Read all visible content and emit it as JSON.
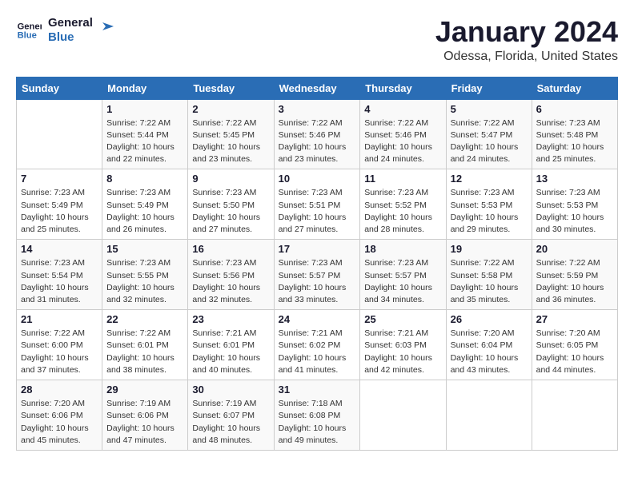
{
  "logo": {
    "line1": "General",
    "line2": "Blue"
  },
  "title": "January 2024",
  "subtitle": "Odessa, Florida, United States",
  "weekdays": [
    "Sunday",
    "Monday",
    "Tuesday",
    "Wednesday",
    "Thursday",
    "Friday",
    "Saturday"
  ],
  "weeks": [
    [
      {
        "day": "",
        "sunrise": "",
        "sunset": "",
        "daylight": ""
      },
      {
        "day": "1",
        "sunrise": "Sunrise: 7:22 AM",
        "sunset": "Sunset: 5:44 PM",
        "daylight": "Daylight: 10 hours and 22 minutes."
      },
      {
        "day": "2",
        "sunrise": "Sunrise: 7:22 AM",
        "sunset": "Sunset: 5:45 PM",
        "daylight": "Daylight: 10 hours and 23 minutes."
      },
      {
        "day": "3",
        "sunrise": "Sunrise: 7:22 AM",
        "sunset": "Sunset: 5:46 PM",
        "daylight": "Daylight: 10 hours and 23 minutes."
      },
      {
        "day": "4",
        "sunrise": "Sunrise: 7:22 AM",
        "sunset": "Sunset: 5:46 PM",
        "daylight": "Daylight: 10 hours and 24 minutes."
      },
      {
        "day": "5",
        "sunrise": "Sunrise: 7:22 AM",
        "sunset": "Sunset: 5:47 PM",
        "daylight": "Daylight: 10 hours and 24 minutes."
      },
      {
        "day": "6",
        "sunrise": "Sunrise: 7:23 AM",
        "sunset": "Sunset: 5:48 PM",
        "daylight": "Daylight: 10 hours and 25 minutes."
      }
    ],
    [
      {
        "day": "7",
        "sunrise": "Sunrise: 7:23 AM",
        "sunset": "Sunset: 5:49 PM",
        "daylight": "Daylight: 10 hours and 25 minutes."
      },
      {
        "day": "8",
        "sunrise": "Sunrise: 7:23 AM",
        "sunset": "Sunset: 5:49 PM",
        "daylight": "Daylight: 10 hours and 26 minutes."
      },
      {
        "day": "9",
        "sunrise": "Sunrise: 7:23 AM",
        "sunset": "Sunset: 5:50 PM",
        "daylight": "Daylight: 10 hours and 27 minutes."
      },
      {
        "day": "10",
        "sunrise": "Sunrise: 7:23 AM",
        "sunset": "Sunset: 5:51 PM",
        "daylight": "Daylight: 10 hours and 27 minutes."
      },
      {
        "day": "11",
        "sunrise": "Sunrise: 7:23 AM",
        "sunset": "Sunset: 5:52 PM",
        "daylight": "Daylight: 10 hours and 28 minutes."
      },
      {
        "day": "12",
        "sunrise": "Sunrise: 7:23 AM",
        "sunset": "Sunset: 5:53 PM",
        "daylight": "Daylight: 10 hours and 29 minutes."
      },
      {
        "day": "13",
        "sunrise": "Sunrise: 7:23 AM",
        "sunset": "Sunset: 5:53 PM",
        "daylight": "Daylight: 10 hours and 30 minutes."
      }
    ],
    [
      {
        "day": "14",
        "sunrise": "Sunrise: 7:23 AM",
        "sunset": "Sunset: 5:54 PM",
        "daylight": "Daylight: 10 hours and 31 minutes."
      },
      {
        "day": "15",
        "sunrise": "Sunrise: 7:23 AM",
        "sunset": "Sunset: 5:55 PM",
        "daylight": "Daylight: 10 hours and 32 minutes."
      },
      {
        "day": "16",
        "sunrise": "Sunrise: 7:23 AM",
        "sunset": "Sunset: 5:56 PM",
        "daylight": "Daylight: 10 hours and 32 minutes."
      },
      {
        "day": "17",
        "sunrise": "Sunrise: 7:23 AM",
        "sunset": "Sunset: 5:57 PM",
        "daylight": "Daylight: 10 hours and 33 minutes."
      },
      {
        "day": "18",
        "sunrise": "Sunrise: 7:23 AM",
        "sunset": "Sunset: 5:57 PM",
        "daylight": "Daylight: 10 hours and 34 minutes."
      },
      {
        "day": "19",
        "sunrise": "Sunrise: 7:22 AM",
        "sunset": "Sunset: 5:58 PM",
        "daylight": "Daylight: 10 hours and 35 minutes."
      },
      {
        "day": "20",
        "sunrise": "Sunrise: 7:22 AM",
        "sunset": "Sunset: 5:59 PM",
        "daylight": "Daylight: 10 hours and 36 minutes."
      }
    ],
    [
      {
        "day": "21",
        "sunrise": "Sunrise: 7:22 AM",
        "sunset": "Sunset: 6:00 PM",
        "daylight": "Daylight: 10 hours and 37 minutes."
      },
      {
        "day": "22",
        "sunrise": "Sunrise: 7:22 AM",
        "sunset": "Sunset: 6:01 PM",
        "daylight": "Daylight: 10 hours and 38 minutes."
      },
      {
        "day": "23",
        "sunrise": "Sunrise: 7:21 AM",
        "sunset": "Sunset: 6:01 PM",
        "daylight": "Daylight: 10 hours and 40 minutes."
      },
      {
        "day": "24",
        "sunrise": "Sunrise: 7:21 AM",
        "sunset": "Sunset: 6:02 PM",
        "daylight": "Daylight: 10 hours and 41 minutes."
      },
      {
        "day": "25",
        "sunrise": "Sunrise: 7:21 AM",
        "sunset": "Sunset: 6:03 PM",
        "daylight": "Daylight: 10 hours and 42 minutes."
      },
      {
        "day": "26",
        "sunrise": "Sunrise: 7:20 AM",
        "sunset": "Sunset: 6:04 PM",
        "daylight": "Daylight: 10 hours and 43 minutes."
      },
      {
        "day": "27",
        "sunrise": "Sunrise: 7:20 AM",
        "sunset": "Sunset: 6:05 PM",
        "daylight": "Daylight: 10 hours and 44 minutes."
      }
    ],
    [
      {
        "day": "28",
        "sunrise": "Sunrise: 7:20 AM",
        "sunset": "Sunset: 6:06 PM",
        "daylight": "Daylight: 10 hours and 45 minutes."
      },
      {
        "day": "29",
        "sunrise": "Sunrise: 7:19 AM",
        "sunset": "Sunset: 6:06 PM",
        "daylight": "Daylight: 10 hours and 47 minutes."
      },
      {
        "day": "30",
        "sunrise": "Sunrise: 7:19 AM",
        "sunset": "Sunset: 6:07 PM",
        "daylight": "Daylight: 10 hours and 48 minutes."
      },
      {
        "day": "31",
        "sunrise": "Sunrise: 7:18 AM",
        "sunset": "Sunset: 6:08 PM",
        "daylight": "Daylight: 10 hours and 49 minutes."
      },
      {
        "day": "",
        "sunrise": "",
        "sunset": "",
        "daylight": ""
      },
      {
        "day": "",
        "sunrise": "",
        "sunset": "",
        "daylight": ""
      },
      {
        "day": "",
        "sunrise": "",
        "sunset": "",
        "daylight": ""
      }
    ]
  ]
}
